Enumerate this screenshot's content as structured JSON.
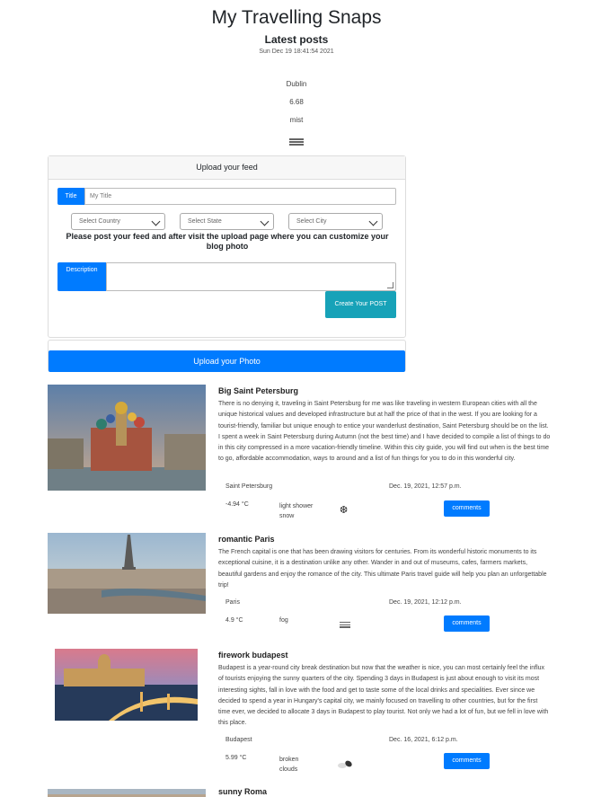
{
  "header": {
    "site_title": "My Travelling Snaps",
    "section_title": "Latest posts",
    "datetime": "Sun Dec 19 18:41:54 2021"
  },
  "weather": {
    "city": "Dublin",
    "temperature": "6.68",
    "description": "mist",
    "icon": "fog-icon"
  },
  "upload_form": {
    "header": "Upload your feed",
    "title_label": "Title",
    "title_placeholder": "My Title",
    "country_select": "Select Country",
    "state_select": "Select State",
    "city_select": "Select City",
    "note": "Please post your feed and after visit the upload page where you can customize your blog photo",
    "description_label": "Description",
    "submit_label": "Create Your POST"
  },
  "upload_photo": {
    "button_label": "Upload your Photo"
  },
  "posts": [
    {
      "title": "Big Saint Petersburg",
      "body": "There is no denying it, traveling in Saint Petersburg for me was like traveling in western European cities with all the unique historical values and developed infrastructure but at half the price of that in the west. If you are looking for a tourist-friendly, familiar but unique enough to entice your wanderlust destination, Saint Petersburg should be on the list. I spent a week in Saint Petersburg during Autumn (not the best time) and I have decided to compile a list of things to do in this city compressed in a more vacation-friendly timeline. Within this city guide, you will find out when is the best time to go, affordable accommodation, ways to around and a list of fun things for you to do in this wonderful city.",
      "city": "Saint Petersburg",
      "date": "Dec. 19, 2021, 12:57 p.m.",
      "temperature": "-4.94 °C",
      "weather": "light shower snow",
      "weather_icon": "snowflake-icon",
      "comments_label": "comments"
    },
    {
      "title": "romantic Paris",
      "body": "The French capital is one that has been drawing visitors for centuries. From its wonderful historic monuments to its exceptional cuisine, it is a destination unlike any other. Wander in and out of museums, cafes, farmers markets, beautiful gardens and enjoy the romance of the city. This ultimate Paris travel guide will help you plan an unforgettable trip!",
      "city": "Paris",
      "date": "Dec. 19, 2021, 12:12 p.m.",
      "temperature": "4.9 °C",
      "weather": "fog",
      "weather_icon": "fog-icon",
      "comments_label": "comments"
    },
    {
      "title": "firework budapest",
      "body": "Budapest is a year-round city break destination but now that the weather is nice, you can most certainly feel the influx of tourists enjoying the sunny quarters of the city. Spending 3 days in Budapest is just about enough to visit its most interesting sights, fall in love with the food and get to taste some of the local drinks and specialities. Ever since we decided to spend a year in Hungary's capital city, we mainly focused on travelling to other countries, but for the first time ever, we decided to allocate 3 days in Budapest to play tourist. Not only we had a lot of fun, but we fell in love with this place.",
      "city": "Budapest",
      "date": "Dec. 16, 2021, 6:12 p.m.",
      "temperature": "5.99 °C",
      "weather": "broken clouds",
      "weather_icon": "broken-clouds-icon",
      "comments_label": "comments"
    },
    {
      "title": "sunny Roma"
    }
  ]
}
